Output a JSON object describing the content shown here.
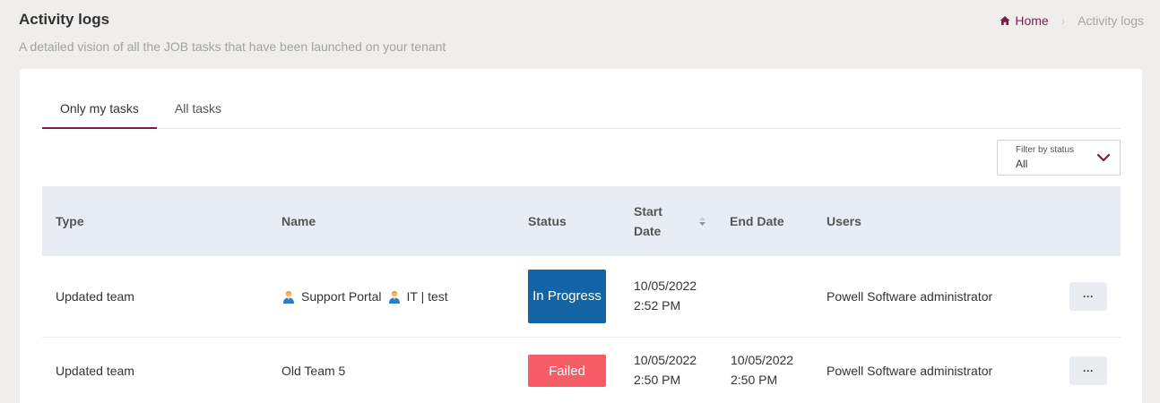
{
  "header": {
    "title": "Activity logs",
    "subtitle": "A detailed vision of all the JOB tasks that have been launched on your tenant"
  },
  "breadcrumb": {
    "home_label": "Home",
    "home_icon": "home-icon",
    "separator": "›",
    "current": "Activity logs"
  },
  "tabs": [
    {
      "label": "Only my tasks",
      "active": true
    },
    {
      "label": "All tasks",
      "active": false
    }
  ],
  "filter": {
    "label": "Filter by status",
    "value": "All",
    "icon": "chevron-down-icon"
  },
  "table": {
    "columns": {
      "type": "Type",
      "name": "Name",
      "status": "Status",
      "start_date": "Start Date",
      "end_date": "End Date",
      "users": "Users"
    },
    "rows": [
      {
        "type": "Updated team",
        "name_parts": [
          "Support Portal",
          "IT | test"
        ],
        "name_icon": "person-emoji-icon",
        "status": "In Progress",
        "status_color": "#1464a5",
        "start_date": "10/05/2022",
        "start_time": "2:52 PM",
        "end_date": "",
        "end_time": "",
        "users": "Powell Software administrator",
        "action_label": "···"
      },
      {
        "type": "Updated team",
        "name": "Old Team 5",
        "status": "Failed",
        "status_color": "#f65d66",
        "start_date": "10/05/2022",
        "start_time": "2:50 PM",
        "end_date": "10/05/2022",
        "end_time": "2:50 PM",
        "users": "Powell Software administrator",
        "action_label": "···"
      }
    ]
  },
  "colors": {
    "accent": "#7b1d4a",
    "header_bg": "#e8edf5",
    "page_bg": "#efeeec"
  }
}
